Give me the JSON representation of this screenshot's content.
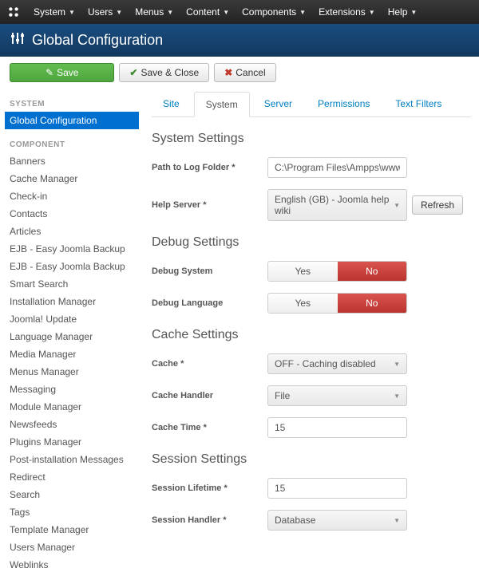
{
  "topmenu": [
    "System",
    "Users",
    "Menus",
    "Content",
    "Components",
    "Extensions",
    "Help"
  ],
  "page_title": "Global Configuration",
  "toolbar": {
    "save": "Save",
    "save_close": "Save & Close",
    "cancel": "Cancel"
  },
  "sidebar": {
    "head1": "SYSTEM",
    "active": "Global Configuration",
    "head2": "COMPONENT",
    "items": [
      "Banners",
      "Cache Manager",
      "Check-in",
      "Contacts",
      "Articles",
      "EJB - Easy Joomla Backup",
      "EJB - Easy Joomla Backup",
      "Smart Search",
      "Installation Manager",
      "Joomla! Update",
      "Language Manager",
      "Media Manager",
      "Menus Manager",
      "Messaging",
      "Module Manager",
      "Newsfeeds",
      "Plugins Manager",
      "Post-installation Messages",
      "Redirect",
      "Search",
      "Tags",
      "Template Manager",
      "Users Manager",
      "Weblinks"
    ]
  },
  "tabs": [
    "Site",
    "System",
    "Server",
    "Permissions",
    "Text Filters"
  ],
  "sections": {
    "s1": "System Settings",
    "s2": "Debug Settings",
    "s3": "Cache Settings",
    "s4": "Session Settings"
  },
  "fields": {
    "log_path_label": "Path to Log Folder *",
    "log_path_value": "C:\\Program Files\\Ampps\\www\\Joc",
    "help_server_label": "Help Server *",
    "help_server_value": "English (GB) - Joomla help wiki",
    "refresh": "Refresh",
    "debug_system_label": "Debug System",
    "debug_language_label": "Debug Language",
    "yes": "Yes",
    "no": "No",
    "cache_label": "Cache *",
    "cache_value": "OFF - Caching disabled",
    "cache_handler_label": "Cache Handler",
    "cache_handler_value": "File",
    "cache_time_label": "Cache Time *",
    "cache_time_value": "15",
    "session_lifetime_label": "Session Lifetime *",
    "session_lifetime_value": "15",
    "session_handler_label": "Session Handler *",
    "session_handler_value": "Database"
  },
  "chart_data": null
}
